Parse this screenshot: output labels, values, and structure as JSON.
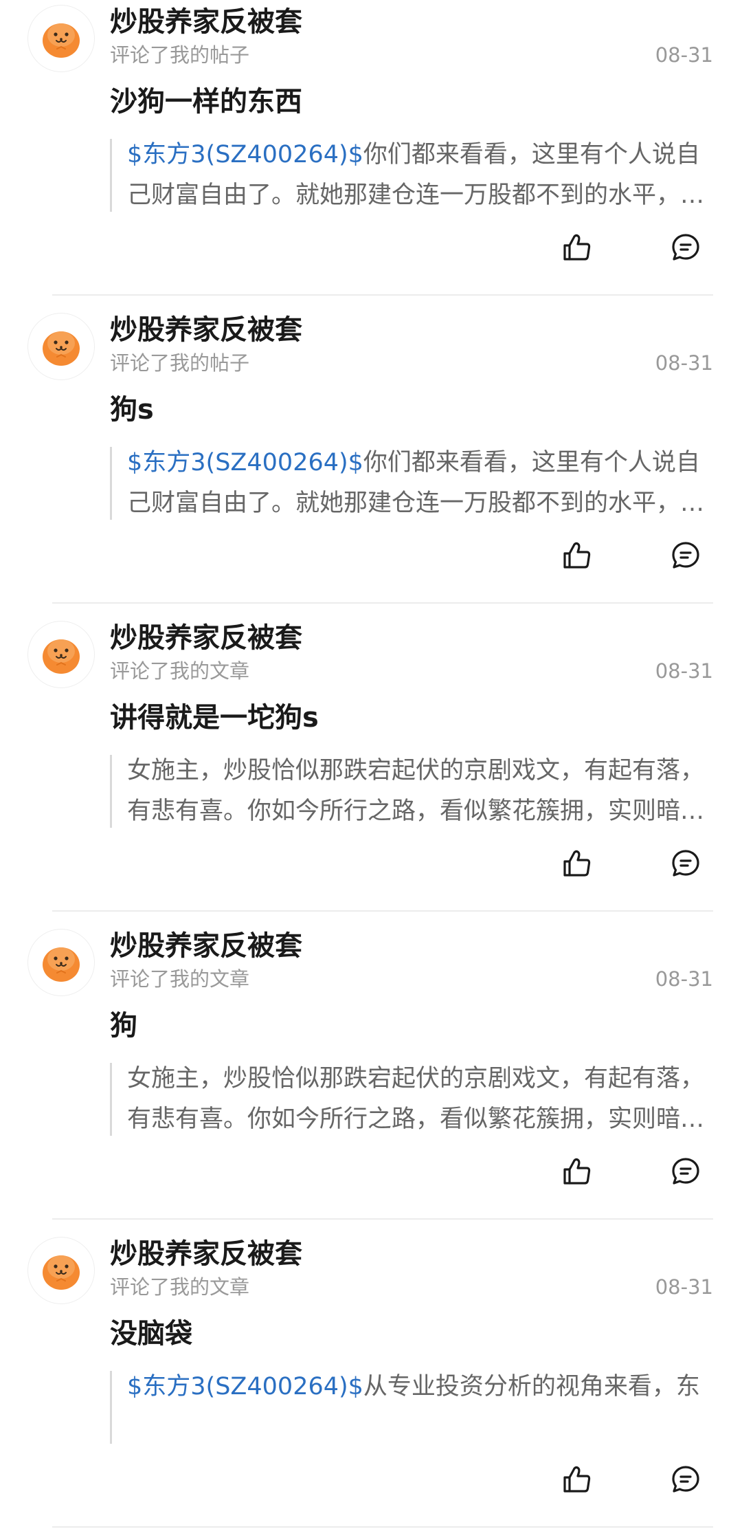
{
  "colors": {
    "stock_link": "#2a6fc2",
    "avatar_orange": "#f58a32",
    "meta_gray": "#999999",
    "quote_gray": "#666666"
  },
  "icons": {
    "like": "thumbs-up-icon",
    "reply": "comment-icon",
    "avatar": "orange-cartoon-avatar"
  },
  "notifications": [
    {
      "username": "炒股养家反被套",
      "action": "评论了我的帖子",
      "date": "08-31",
      "comment": "沙狗一样的东西",
      "quote_link": "$东方3(SZ400264)$",
      "quote_text": "你们都来看看，这里有个人说自己财富自由了。就她那建仓连一万股都不到的水平，你们都来看看，这里有个人说自己财富自由了。"
    },
    {
      "username": "炒股养家反被套",
      "action": "评论了我的帖子",
      "date": "08-31",
      "comment": "狗s",
      "quote_link": "$东方3(SZ400264)$",
      "quote_text": "你们都来看看，这里有个人说自己财富自由了。就她那建仓连一万股都不到的水平，你们都来看看，这里有个人说自己财富自由了。"
    },
    {
      "username": "炒股养家反被套",
      "action": "评论了我的文章",
      "date": "08-31",
      "comment": "讲得就是一坨狗s",
      "quote_link": "",
      "quote_text": "女施主，炒股恰似那跌宕起伏的京剧戏文，有起有落，有悲有喜。你如今所行之路，看似繁花簇拥，实则暗藏玄机，切莫贪恋一时风光。"
    },
    {
      "username": "炒股养家反被套",
      "action": "评论了我的文章",
      "date": "08-31",
      "comment": "狗",
      "quote_link": "",
      "quote_text": "女施主，炒股恰似那跌宕起伏的京剧戏文，有起有落，有悲有喜。你如今所行之路，看似繁花簇拥，实则暗藏玄机，切莫贪恋一时风光。"
    },
    {
      "username": "炒股养家反被套",
      "action": "评论了我的文章",
      "date": "08-31",
      "comment": "没脑袋",
      "quote_link": "$东方3(SZ400264)$",
      "quote_text": "从专业投资分析的视角来看，东"
    }
  ]
}
